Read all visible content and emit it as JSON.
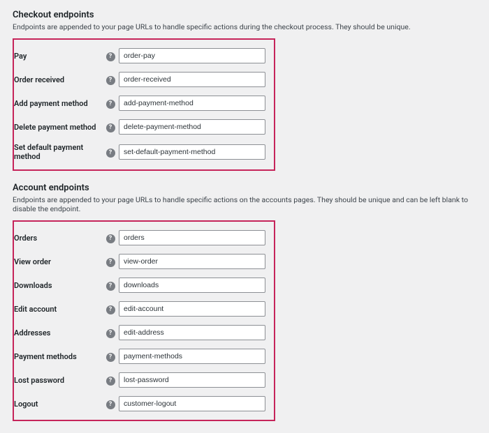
{
  "checkout": {
    "title": "Checkout endpoints",
    "desc": "Endpoints are appended to your page URLs to handle specific actions during the checkout process. They should be unique.",
    "fields": {
      "pay": {
        "label": "Pay",
        "value": "order-pay"
      },
      "received": {
        "label": "Order received",
        "value": "order-received"
      },
      "add_pm": {
        "label": "Add payment method",
        "value": "add-payment-method"
      },
      "delete_pm": {
        "label": "Delete payment method",
        "value": "delete-payment-method"
      },
      "default_pm": {
        "label": "Set default payment method",
        "value": "set-default-payment-method"
      }
    }
  },
  "account": {
    "title": "Account endpoints",
    "desc": "Endpoints are appended to your page URLs to handle specific actions on the accounts pages. They should be unique and can be left blank to disable the endpoint.",
    "fields": {
      "orders": {
        "label": "Orders",
        "value": "orders"
      },
      "view_order": {
        "label": "View order",
        "value": "view-order"
      },
      "downloads": {
        "label": "Downloads",
        "value": "downloads"
      },
      "edit_acct": {
        "label": "Edit account",
        "value": "edit-account"
      },
      "addresses": {
        "label": "Addresses",
        "value": "edit-address"
      },
      "paymeth": {
        "label": "Payment methods",
        "value": "payment-methods"
      },
      "lost_pw": {
        "label": "Lost password",
        "value": "lost-password"
      },
      "logout": {
        "label": "Logout",
        "value": "customer-logout"
      }
    }
  },
  "help_glyph": "?"
}
